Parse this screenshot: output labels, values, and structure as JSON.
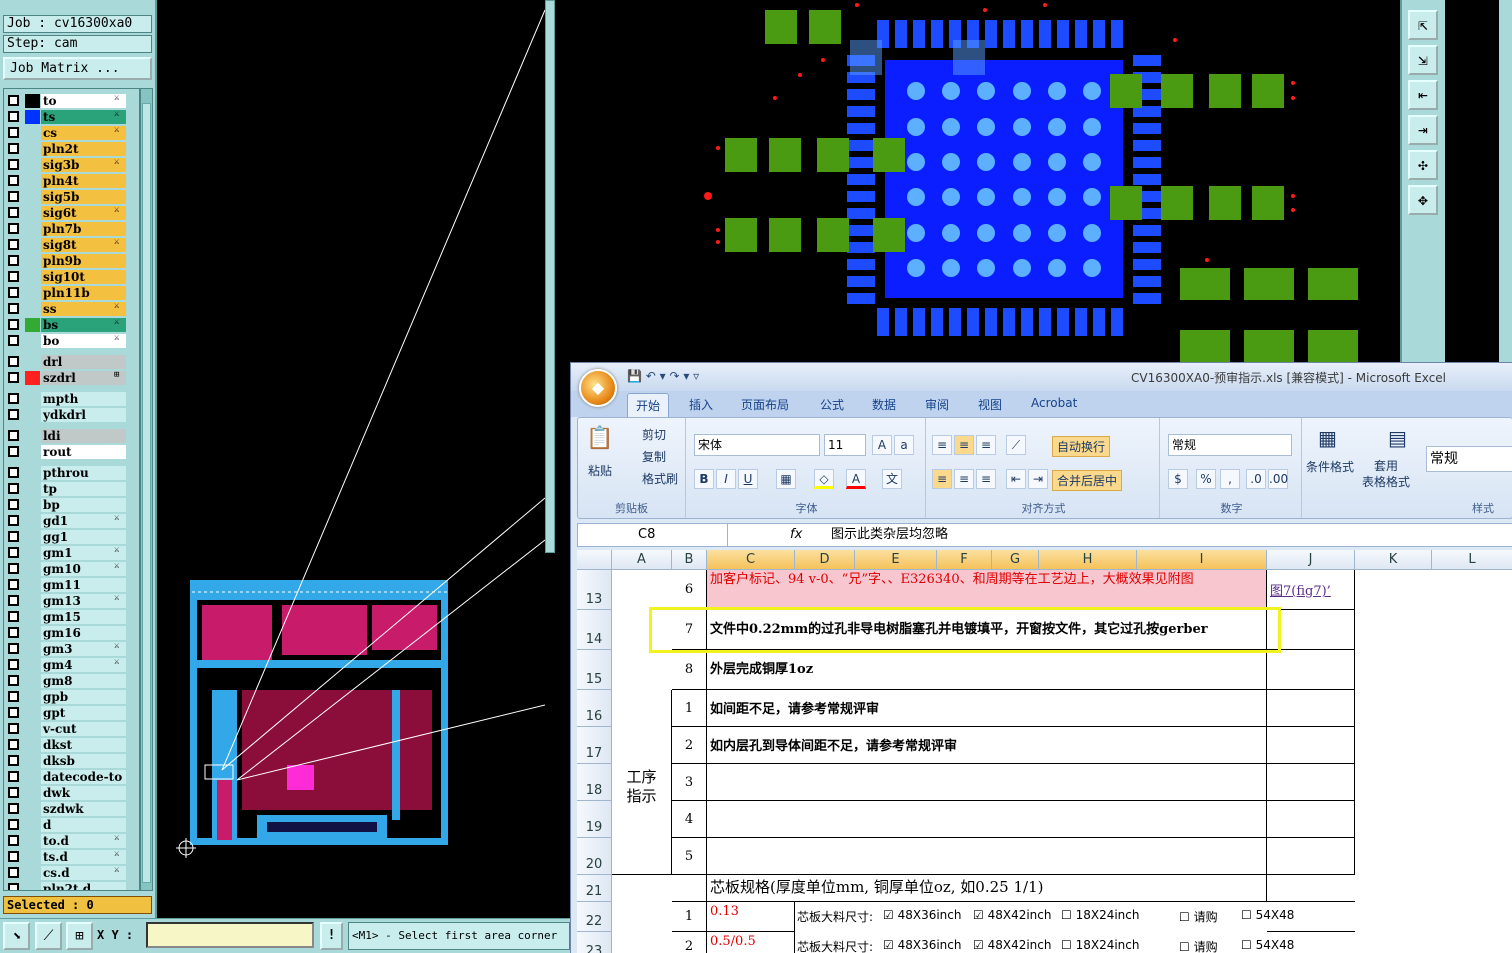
{
  "job": {
    "line": "Job : cv16300xa0",
    "step": "Step: cam",
    "matrix_button": "Job Matrix ..."
  },
  "layers": [
    {
      "name": "to",
      "color": "#ffffff",
      "swatch": "#000000",
      "mark": "⚔"
    },
    {
      "name": "ts",
      "color": "#2aa37a",
      "swatch": "#0033ff",
      "mark": "⚔"
    },
    {
      "name": "cs",
      "color": "#f4c040",
      "swatch": "",
      "mark": "⚔"
    },
    {
      "name": "pln2t",
      "color": "#f4c040",
      "swatch": "",
      "mark": ""
    },
    {
      "name": "sig3b",
      "color": "#f4c040",
      "swatch": "",
      "mark": "⚔"
    },
    {
      "name": "pln4t",
      "color": "#f4c040",
      "swatch": "",
      "mark": ""
    },
    {
      "name": "sig5b",
      "color": "#f4c040",
      "swatch": "",
      "mark": ""
    },
    {
      "name": "sig6t",
      "color": "#f4c040",
      "swatch": "",
      "mark": "⚔"
    },
    {
      "name": "pln7b",
      "color": "#f4c040",
      "swatch": "",
      "mark": ""
    },
    {
      "name": "sig8t",
      "color": "#f4c040",
      "swatch": "",
      "mark": "⚔"
    },
    {
      "name": "pln9b",
      "color": "#f4c040",
      "swatch": "",
      "mark": ""
    },
    {
      "name": "sig10t",
      "color": "#f4c040",
      "swatch": "",
      "mark": ""
    },
    {
      "name": "pln11b",
      "color": "#f4c040",
      "swatch": "",
      "mark": ""
    },
    {
      "name": "ss",
      "color": "#f4c040",
      "swatch": "",
      "mark": "⚔"
    },
    {
      "name": "bs",
      "color": "#2aa37a",
      "swatch": "#33aa33",
      "mark": "⚔"
    },
    {
      "name": "bo",
      "color": "#ffffff",
      "swatch": "",
      "mark": "⚔"
    },
    {
      "name": "drl",
      "color": "#c0c8c8",
      "swatch": "",
      "mark": "",
      "gap": true
    },
    {
      "name": "szdrl",
      "color": "#c0c8c8",
      "swatch": "#ff2020",
      "mark": "⊞"
    },
    {
      "name": "mpth",
      "color": "#c9ecec",
      "swatch": "",
      "mark": "",
      "gap": true
    },
    {
      "name": "ydkdrl",
      "color": "#c9ecec",
      "swatch": "",
      "mark": ""
    },
    {
      "name": "ldi",
      "color": "#c0c8c8",
      "swatch": "",
      "mark": "",
      "gap": true
    },
    {
      "name": "rout",
      "color": "#ffffff",
      "swatch": "",
      "mark": ""
    },
    {
      "name": "pthrou",
      "color": "#c9ecec",
      "swatch": "",
      "mark": "",
      "gap": true
    },
    {
      "name": "tp",
      "color": "#c9ecec",
      "swatch": "",
      "mark": ""
    },
    {
      "name": "bp",
      "color": "#c9ecec",
      "swatch": "",
      "mark": ""
    },
    {
      "name": "gd1",
      "color": "#c9ecec",
      "swatch": "",
      "mark": "⚔"
    },
    {
      "name": "gg1",
      "color": "#c9ecec",
      "swatch": "",
      "mark": ""
    },
    {
      "name": "gm1",
      "color": "#c9ecec",
      "swatch": "",
      "mark": "⚔"
    },
    {
      "name": "gm10",
      "color": "#c9ecec",
      "swatch": "",
      "mark": "⚔"
    },
    {
      "name": "gm11",
      "color": "#c9ecec",
      "swatch": "",
      "mark": ""
    },
    {
      "name": "gm13",
      "color": "#c9ecec",
      "swatch": "",
      "mark": "⚔"
    },
    {
      "name": "gm15",
      "color": "#c9ecec",
      "swatch": "",
      "mark": ""
    },
    {
      "name": "gm16",
      "color": "#c9ecec",
      "swatch": "",
      "mark": ""
    },
    {
      "name": "gm3",
      "color": "#c9ecec",
      "swatch": "",
      "mark": "⚔"
    },
    {
      "name": "gm4",
      "color": "#c9ecec",
      "swatch": "",
      "mark": "⚔"
    },
    {
      "name": "gm8",
      "color": "#c9ecec",
      "swatch": "",
      "mark": ""
    },
    {
      "name": "gpb",
      "color": "#c9ecec",
      "swatch": "",
      "mark": ""
    },
    {
      "name": "gpt",
      "color": "#c9ecec",
      "swatch": "",
      "mark": ""
    },
    {
      "name": "v-cut",
      "color": "#c9ecec",
      "swatch": "",
      "mark": ""
    },
    {
      "name": "dkst",
      "color": "#c9ecec",
      "swatch": "",
      "mark": ""
    },
    {
      "name": "dksb",
      "color": "#c9ecec",
      "swatch": "",
      "mark": ""
    },
    {
      "name": "datecode-to",
      "color": "#c9ecec",
      "swatch": "",
      "mark": ""
    },
    {
      "name": "dwk",
      "color": "#c9ecec",
      "swatch": "",
      "mark": ""
    },
    {
      "name": "szdwk",
      "color": "#c9ecec",
      "swatch": "",
      "mark": ""
    },
    {
      "name": "d",
      "color": "#c9ecec",
      "swatch": "",
      "mark": ""
    },
    {
      "name": "to.d",
      "color": "#c9ecec",
      "swatch": "",
      "mark": "⚔"
    },
    {
      "name": "ts.d",
      "color": "#c9ecec",
      "swatch": "",
      "mark": "⚔"
    },
    {
      "name": "cs.d",
      "color": "#c9ecec",
      "swatch": "",
      "mark": "⚔"
    },
    {
      "name": "pln2t.d",
      "color": "#c9ecec",
      "swatch": "",
      "mark": ""
    }
  ],
  "selected": "Selected : 0",
  "bottom": {
    "xy_label": "X Y :",
    "xy_value": "",
    "status_button": "!",
    "status_message": "<M1> - Select first area corner"
  },
  "excel": {
    "title": "CV16300XA0-预审指示.xls  [兼容模式] - Microsoft Excel",
    "tabs": [
      "开始",
      "插入",
      "页面布局",
      "公式",
      "数据",
      "审阅",
      "视图",
      "Acrobat"
    ],
    "clipboard": {
      "paste": "粘贴",
      "cut": "剪切",
      "copy": "复制",
      "format_painter": "格式刷",
      "group": "剪贴板"
    },
    "font": {
      "name": "宋体",
      "size": "11",
      "group": "字体"
    },
    "align": {
      "wrap": "自动换行",
      "merge": "合并后居中",
      "group": "对齐方式"
    },
    "number": {
      "format": "常规",
      "group": "数字"
    },
    "styles": {
      "cond": "条件格式",
      "table": "套用\n表格格式",
      "group": "样式",
      "style_box": "常规"
    },
    "name_box": "C8",
    "formula": "图示此类杂层均忽略",
    "columns": [
      "A",
      "B",
      "C",
      "D",
      "E",
      "F",
      "G",
      "H",
      "I",
      "J",
      "K",
      "L"
    ],
    "rows": [
      {
        "row": "13",
        "num": "6",
        "text": "加客户标记、94 v-0、“兄”字、、E326340、和周期等在工艺边上，大概效果见附图",
        "link": "图7(fig7)’"
      },
      {
        "row": "14",
        "num": "7",
        "text": "文件中0.22mm的过孔非导电树脂塞孔并电镀填平，开窗按文件，其它过孔按gerber"
      },
      {
        "row": "15",
        "num": "8",
        "text": "外层完成铜厚1oz"
      },
      {
        "row": "16",
        "num": "1",
        "text": "如间距不足，请参考常规评审"
      },
      {
        "row": "17",
        "num": "2",
        "text": "如内层孔到导体间距不足，请参考常规评审"
      },
      {
        "row": "18",
        "num": "3",
        "text": ""
      },
      {
        "row": "19",
        "num": "4",
        "text": ""
      },
      {
        "row": "20",
        "num": "5",
        "text": ""
      },
      {
        "row": "21",
        "num": "",
        "text": "芯板规格(厚度单位mm, 铜厚单位oz, 如0.25 1/1)"
      },
      {
        "row": "22",
        "num": "1",
        "text": "0.13"
      },
      {
        "row": "23",
        "num": "2",
        "text": "0.5/0.5"
      }
    ],
    "section_label": "工序\n指示",
    "core_row": {
      "label": "芯板大料尺寸:",
      "opt1": "48X36inch",
      "opt2": "48X42inch",
      "opt3": "18X24inch",
      "opt4": "请购",
      "opt5": "54X48"
    }
  }
}
